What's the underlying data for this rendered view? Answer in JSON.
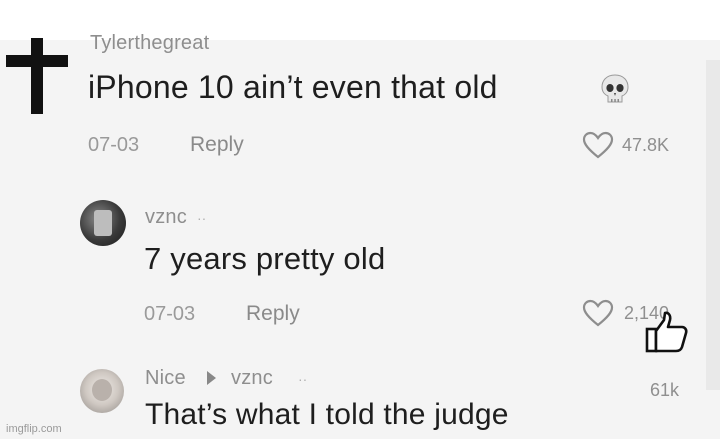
{
  "comments": [
    {
      "username": "Tylerthegreat",
      "text": "iPhone 10 ain’t even that old",
      "date": "07-03",
      "reply_label": "Reply",
      "likes": "47.8K",
      "emoji_icon": "skull-icon"
    },
    {
      "username": "vznc",
      "creator_mark": "··",
      "text": "7 years pretty old",
      "date": "07-03",
      "reply_label": "Reply",
      "likes": "2,140"
    },
    {
      "username": "Nice",
      "reply_to": "vznc",
      "creator_mark": "··",
      "text": "That’s what I told the judge",
      "likes": "61k"
    }
  ],
  "watermark": "imgflip.com",
  "colors": {
    "background": "#f4f4f4",
    "text": "#1e1e1e",
    "muted": "#8e8e8e"
  }
}
